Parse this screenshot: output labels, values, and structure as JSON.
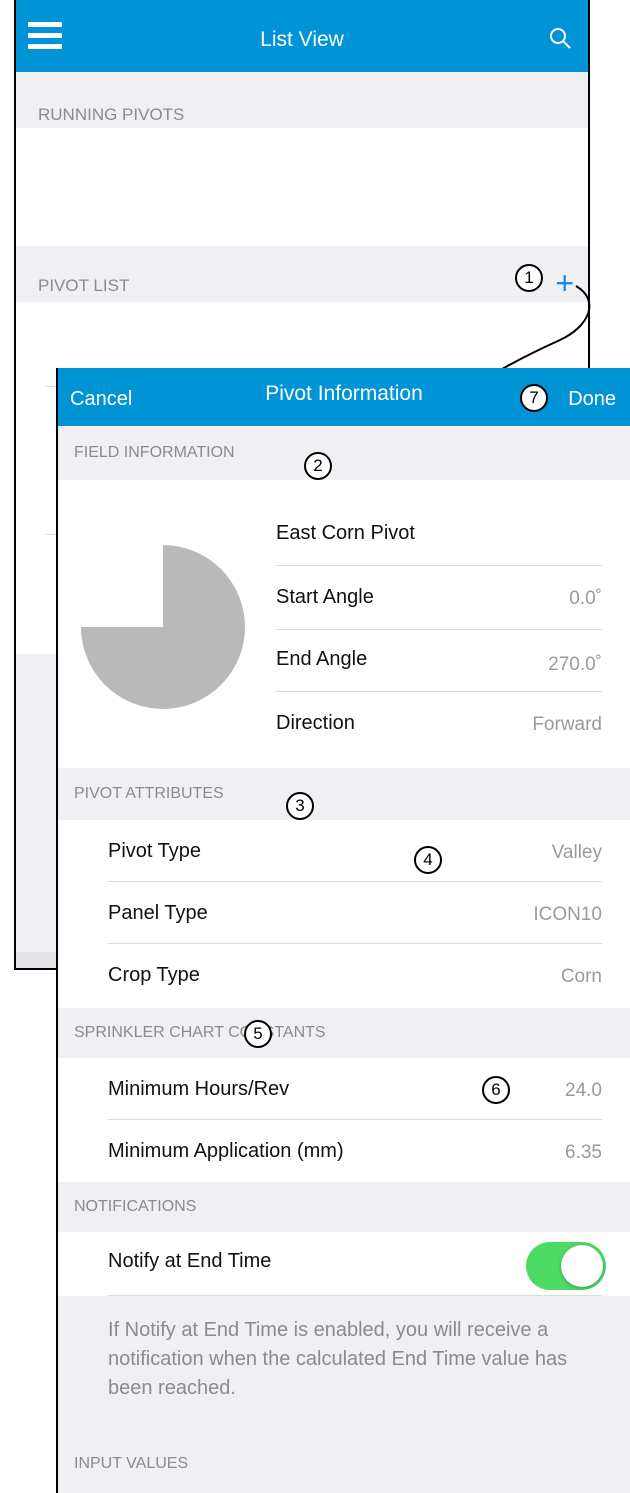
{
  "list_view": {
    "title": "List View",
    "menu_icon": "hamburger-menu-icon",
    "search_icon": "search-icon",
    "running_pivots_header": "RUNNING PIVOTS",
    "pivot_list_header": "PIVOT LIST",
    "add_label": "+"
  },
  "pivot_info": {
    "cancel_label": "Cancel",
    "title": "Pivot Information",
    "done_label": "Done",
    "field_information": {
      "header": "FIELD INFORMATION",
      "name": "East Corn Pivot",
      "start_angle_label": "Start Angle",
      "start_angle_value": "0.0˚",
      "end_angle_label": "End Angle",
      "end_angle_value": "270.0˚",
      "direction_label": "Direction",
      "direction_value": "Forward",
      "pie_degrees": 270
    },
    "pivot_attributes": {
      "header": "PIVOT ATTRIBUTES",
      "rows": [
        {
          "label": "Pivot Type",
          "value": "Valley"
        },
        {
          "label": "Panel Type",
          "value": "ICON10"
        },
        {
          "label": "Crop Type",
          "value": "Corn"
        }
      ]
    },
    "sprinkler_chart_constants": {
      "header": "SPRINKLER CHART CONSTANTS",
      "rows": [
        {
          "label": "Minimum Hours/Rev",
          "value": "24.0"
        },
        {
          "label": "Minimum Application (mm)",
          "value": "6.35"
        }
      ]
    },
    "notifications": {
      "header": "NOTIFICATIONS",
      "notify_label": "Notify at End Time",
      "notify_enabled": true,
      "note": "If Notify at End Time is enabled, you will receive a notification when the calculated End Time value has been reached."
    },
    "input_values_header": "INPUT VALUES"
  },
  "callouts": [
    "1",
    "2",
    "3",
    "4",
    "5",
    "6",
    "7"
  ],
  "colors": {
    "nav_blue": "#0094d6",
    "toggle_green": "#4cd964",
    "pie_gray": "#b9b9b9",
    "accent_blue": "#1e88e5"
  }
}
